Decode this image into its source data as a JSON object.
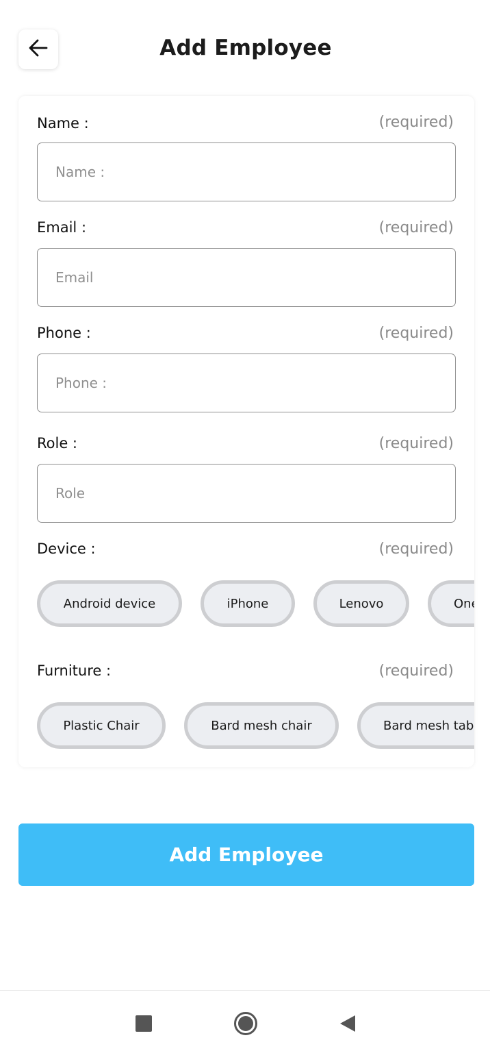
{
  "header": {
    "title": "Add Employee",
    "back_icon": "arrow-left-icon"
  },
  "form": {
    "name": {
      "label": "Name :",
      "required": "(required)",
      "placeholder": "Name :"
    },
    "email": {
      "label": "Email :",
      "required": "(required)",
      "placeholder": "Email"
    },
    "phone": {
      "label": "Phone :",
      "required": "(required)",
      "placeholder": "Phone :"
    },
    "role": {
      "label": "Role :",
      "required": "(required)",
      "placeholder": "Role"
    },
    "device": {
      "label": "Device :",
      "required": "(required)",
      "options": [
        "Android device",
        "iPhone",
        "Lenovo",
        "One"
      ]
    },
    "furniture": {
      "label": "Furniture :",
      "required": "(required)",
      "options": [
        "Plastic Chair",
        "Bard mesh chair",
        "Bard mesh tab"
      ]
    }
  },
  "submit": {
    "label": "Add Employee"
  },
  "colors": {
    "accent": "#3fbdf7",
    "chip_bg": "#eceef2",
    "chip_border": "#cdced1",
    "muted": "#8a8a8a"
  },
  "nav": {
    "recents_icon": "square-icon",
    "home_icon": "circle-icon",
    "back_icon": "triangle-back-icon"
  }
}
